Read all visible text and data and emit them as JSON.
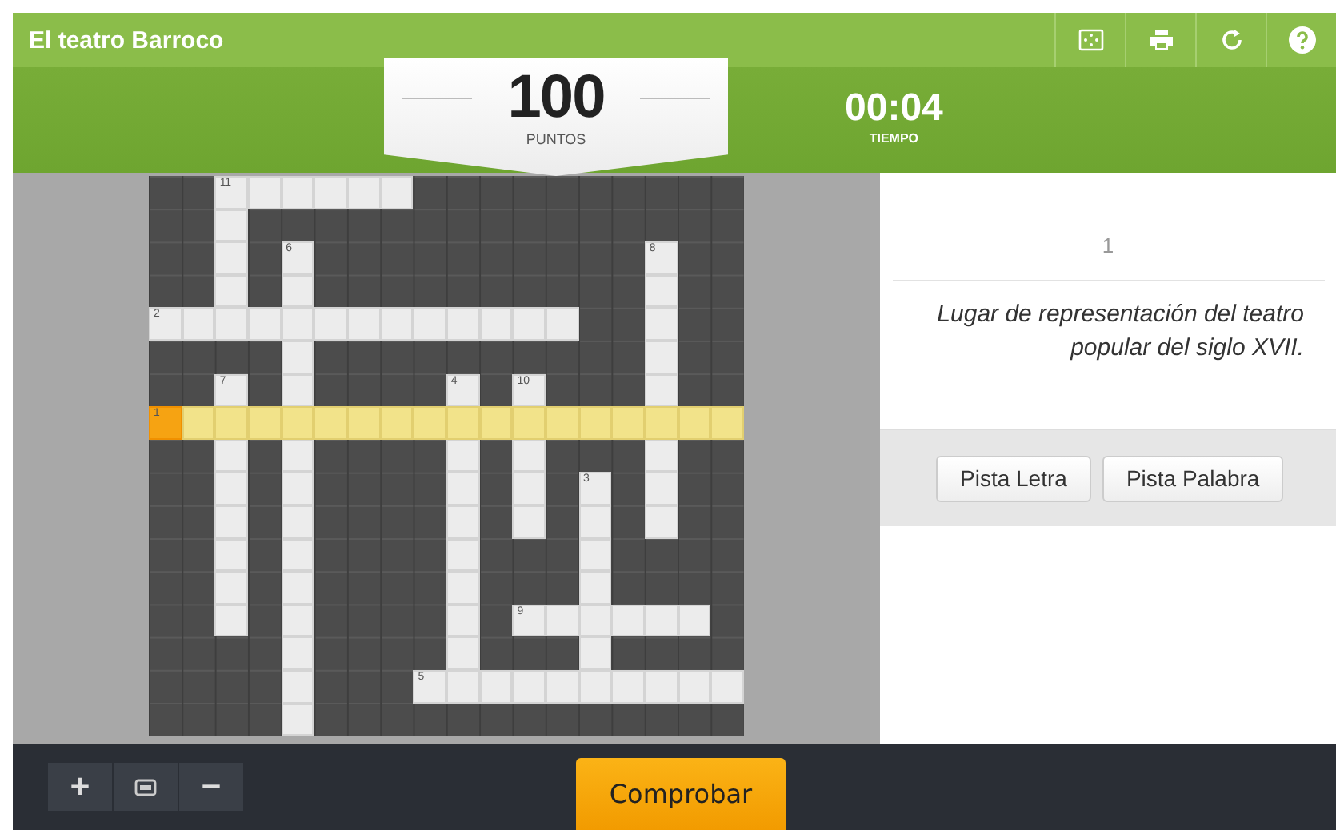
{
  "title": "El teatro Barroco",
  "score": {
    "value": "100",
    "label": "PUNTOS"
  },
  "timer": {
    "value": "00:04",
    "label": "TIEMPO"
  },
  "crossword": {
    "words": [
      {
        "number": "11",
        "selected": false
      },
      {
        "number": "6",
        "selected": false
      },
      {
        "number": "8",
        "selected": false
      },
      {
        "number": "2",
        "selected": false
      },
      {
        "number": "7",
        "selected": false
      },
      {
        "number": "4",
        "selected": false
      },
      {
        "number": "10",
        "selected": false
      },
      {
        "number": "1",
        "selected": true
      },
      {
        "number": "3",
        "selected": false
      },
      {
        "number": "9",
        "selected": false
      },
      {
        "number": "5",
        "selected": false
      }
    ]
  },
  "clue": {
    "number": "1",
    "text": "Lugar de representación del teatro popular del siglo XVII."
  },
  "hint_buttons": [
    "Pista Letra",
    "Pista Palabra"
  ],
  "zoom": {
    "zoom_in": "+",
    "zoom_out": "−"
  },
  "check_button": "Comprobar"
}
